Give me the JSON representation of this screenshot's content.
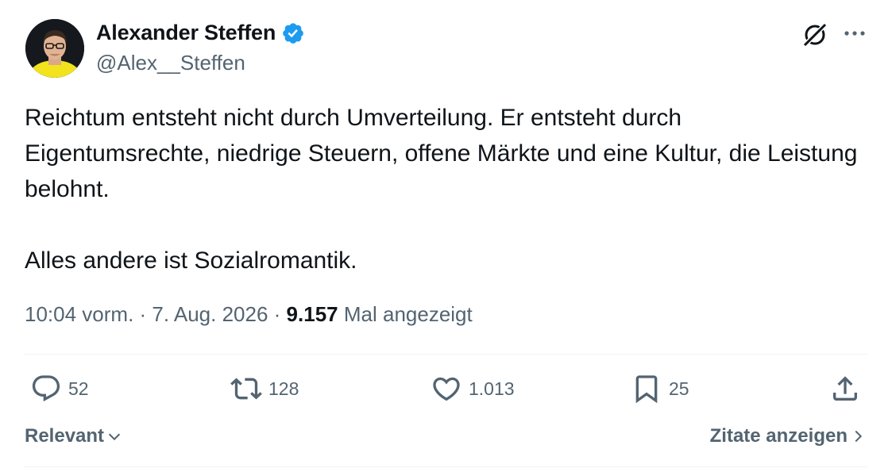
{
  "author": {
    "display_name": "Alexander Steffen",
    "handle": "@Alex__Steffen",
    "verified": true
  },
  "tweet": {
    "paragraph1": "Reichtum entsteht nicht durch Umverteilung. Er entsteht durch Eigentumsrechte, niedrige Steuern, offene Märkte und eine Kultur, die Leistung belohnt.",
    "paragraph2": "Alles andere ist Sozialromantik."
  },
  "meta": {
    "time": "10:04 vorm.",
    "separator": " · ",
    "date": "7. Aug. 2026",
    "views_count": "9.157",
    "views_label": "Mal angezeigt"
  },
  "actions": {
    "replies": "52",
    "reposts": "128",
    "likes": "1.013",
    "bookmarks": "25"
  },
  "footer": {
    "sort_label": "Relevant",
    "quotes_label": "Zitate anzeigen"
  },
  "colors": {
    "text_primary": "#0f1419",
    "text_secondary": "#536471",
    "verified_blue": "#1d9bf0",
    "divider": "#eff3f4"
  },
  "icons": [
    "verified-badge-icon",
    "grok-icon",
    "more-icon",
    "reply-icon",
    "repost-icon",
    "like-icon",
    "bookmark-icon",
    "share-icon",
    "chevron-down-icon",
    "chevron-right-icon"
  ]
}
